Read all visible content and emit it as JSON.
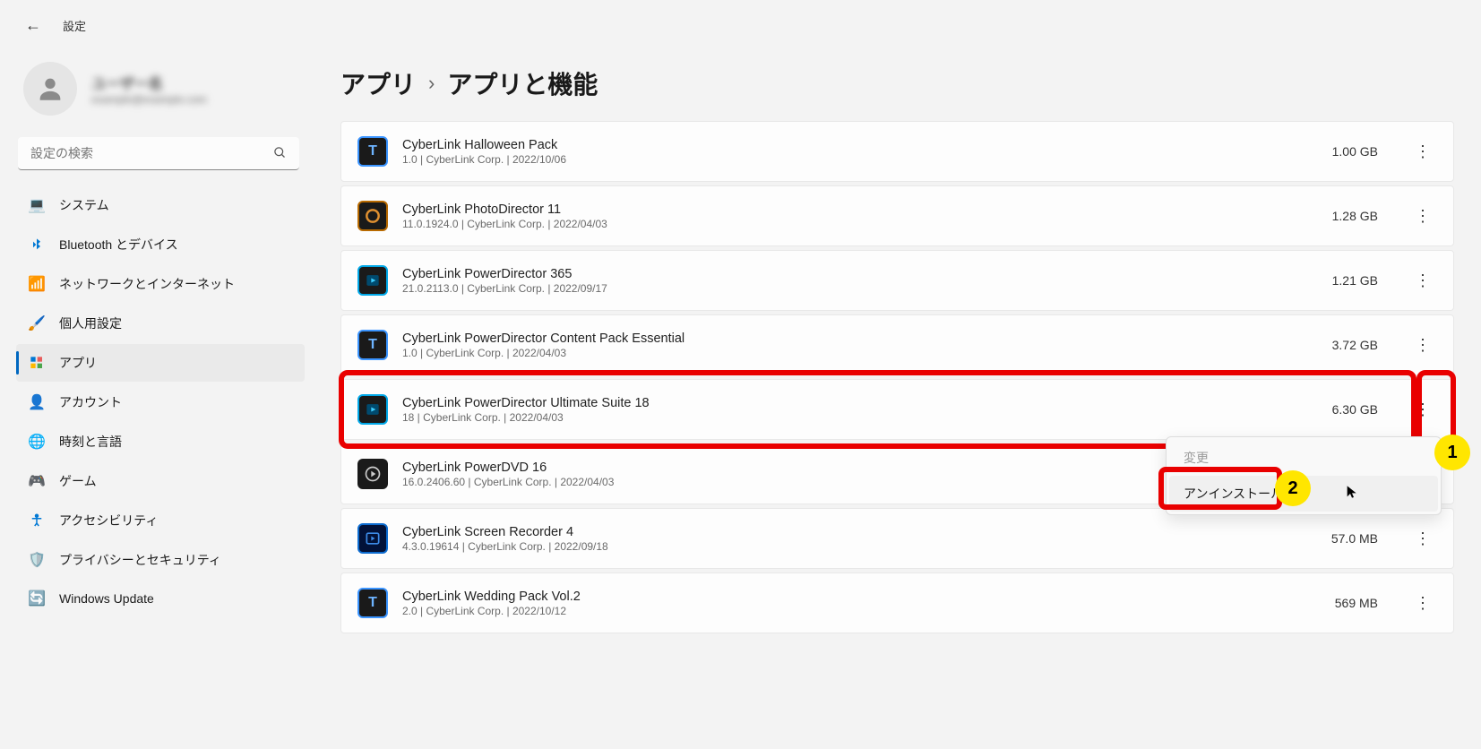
{
  "header": {
    "title": "設定"
  },
  "profile": {
    "name": "ユーザー名",
    "sub": "example@example.com"
  },
  "search": {
    "placeholder": "設定の検索"
  },
  "nav": [
    {
      "key": "system",
      "label": "システム",
      "icon": "💻",
      "color": "#0078d4"
    },
    {
      "key": "bluetooth",
      "label": "Bluetooth とデバイス",
      "icon": "bt"
    },
    {
      "key": "network",
      "label": "ネットワークとインターネット",
      "icon": "📶",
      "color": "#0078d4"
    },
    {
      "key": "personalize",
      "label": "個人用設定",
      "icon": "🖌️"
    },
    {
      "key": "apps",
      "label": "アプリ",
      "icon": "grid",
      "active": true
    },
    {
      "key": "account",
      "label": "アカウント",
      "icon": "👤",
      "color": "#2a8a4a"
    },
    {
      "key": "time",
      "label": "時刻と言語",
      "icon": "🌐",
      "color": "#0078d4"
    },
    {
      "key": "gaming",
      "label": "ゲーム",
      "icon": "🎮",
      "color": "#777"
    },
    {
      "key": "accessibility",
      "label": "アクセシビリティ",
      "icon": "accessibility",
      "color": "#0078d4"
    },
    {
      "key": "privacy",
      "label": "プライバシーとセキュリティ",
      "icon": "🛡️",
      "color": "#888"
    },
    {
      "key": "update",
      "label": "Windows Update",
      "icon": "🔄",
      "color": "#0078d4"
    }
  ],
  "breadcrumb": {
    "parent": "アプリ",
    "current": "アプリと機能"
  },
  "apps": [
    {
      "name": "CyberLink Halloween Pack",
      "version": "1.0",
      "publisher": "CyberLink Corp.",
      "date": "2022/10/06",
      "size": "1.00 GB",
      "icon": "T",
      "iconClass": "icon-t-dark"
    },
    {
      "name": "CyberLink PhotoDirector 11",
      "version": "11.0.1924.0",
      "publisher": "CyberLink Corp.",
      "date": "2022/04/03",
      "size": "1.28 GB",
      "icon": "orange-ring",
      "iconClass": "icon-pd-orange"
    },
    {
      "name": "CyberLink PowerDirector 365",
      "version": "21.0.2113.0",
      "publisher": "CyberLink Corp.",
      "date": "2022/09/17",
      "size": "1.21 GB",
      "icon": "pd",
      "iconClass": "icon-pd-blue"
    },
    {
      "name": "CyberLink PowerDirector Content Pack Essential",
      "version": "1.0",
      "publisher": "CyberLink Corp.",
      "date": "2022/04/03",
      "size": "3.72 GB",
      "icon": "T",
      "iconClass": "icon-t-dark"
    },
    {
      "name": "CyberLink PowerDirector Ultimate Suite 18",
      "version": "18",
      "publisher": "CyberLink Corp.",
      "date": "2022/04/03",
      "size": "6.30 GB",
      "icon": "pd",
      "iconClass": "icon-pd-blue",
      "highlighted": true
    },
    {
      "name": "CyberLink PowerDVD 16",
      "version": "16.0.2406.60",
      "publisher": "CyberLink Corp.",
      "date": "2022/04/03",
      "size": "",
      "icon": "play",
      "iconClass": "icon-pdvd"
    },
    {
      "name": "CyberLink Screen Recorder 4",
      "version": "4.3.0.19614",
      "publisher": "CyberLink Corp.",
      "date": "2022/09/18",
      "size": "57.0 MB",
      "icon": "sr",
      "iconClass": "icon-sr"
    },
    {
      "name": "CyberLink Wedding Pack Vol.2",
      "version": "2.0",
      "publisher": "CyberLink Corp.",
      "date": "2022/10/12",
      "size": "569 MB",
      "icon": "T",
      "iconClass": "icon-t-dark"
    }
  ],
  "menu": {
    "change": "変更",
    "uninstall": "アンインストール"
  },
  "annotations": {
    "badge1": "1",
    "badge2": "2"
  }
}
